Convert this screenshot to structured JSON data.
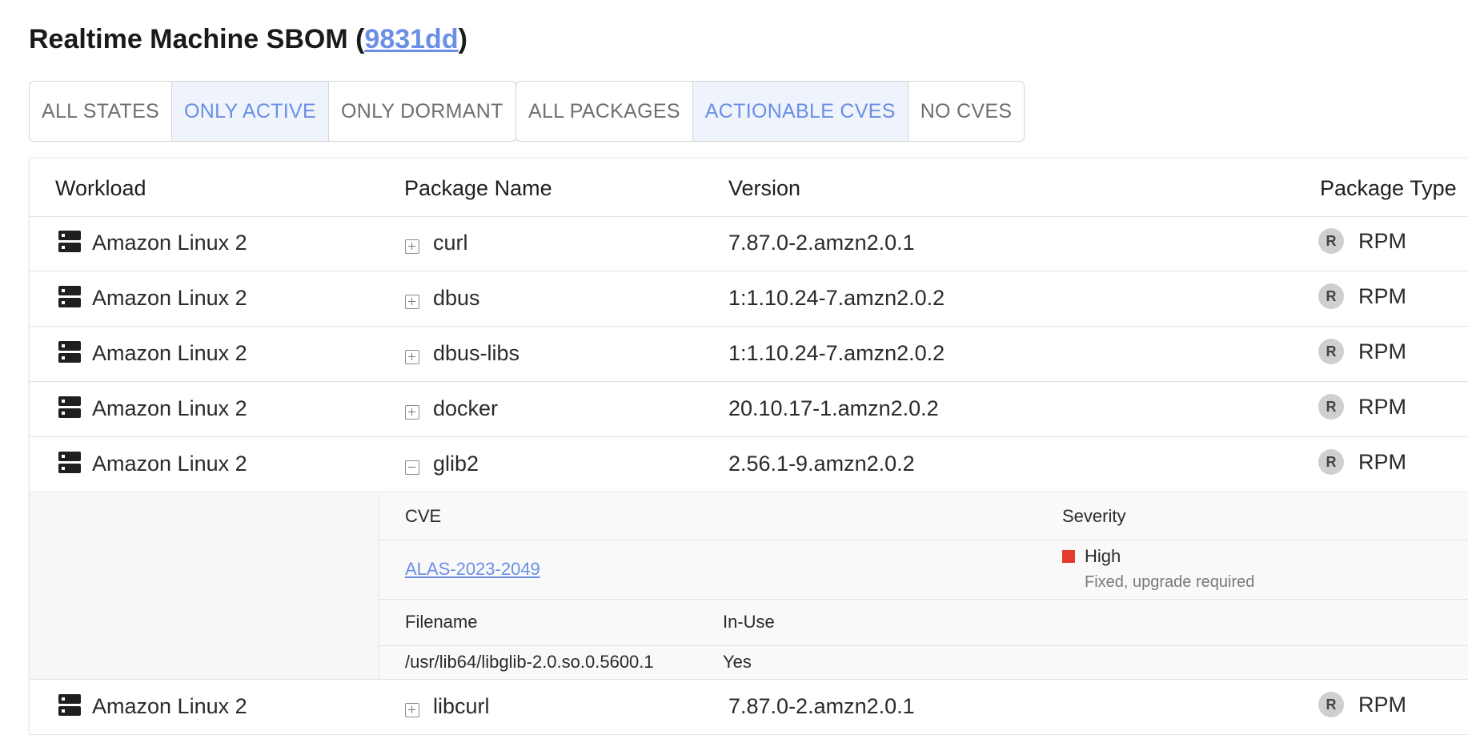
{
  "page": {
    "title_prefix": "Realtime Machine SBOM (",
    "title_hash": "9831dd",
    "title_suffix": ")"
  },
  "filters": {
    "states": [
      {
        "label": "ALL STATES",
        "active": false
      },
      {
        "label": "ONLY ACTIVE",
        "active": true
      },
      {
        "label": "ONLY DORMANT",
        "active": false
      }
    ],
    "packages": [
      {
        "label": "ALL PACKAGES",
        "active": false
      },
      {
        "label": "ACTIONABLE CVES",
        "active": true
      },
      {
        "label": "NO CVES",
        "active": false
      }
    ]
  },
  "table": {
    "headers": {
      "workload": "Workload",
      "package_name": "Package Name",
      "version": "Version",
      "package_type": "Package Type"
    },
    "rows": [
      {
        "workload": "Amazon Linux 2",
        "package": "curl",
        "version": "7.87.0-2.amzn2.0.1",
        "type_badge": "R",
        "type": "RPM",
        "expanded": false
      },
      {
        "workload": "Amazon Linux 2",
        "package": "dbus",
        "version": "1:1.10.24-7.amzn2.0.2",
        "type_badge": "R",
        "type": "RPM",
        "expanded": false
      },
      {
        "workload": "Amazon Linux 2",
        "package": "dbus-libs",
        "version": "1:1.10.24-7.amzn2.0.2",
        "type_badge": "R",
        "type": "RPM",
        "expanded": false
      },
      {
        "workload": "Amazon Linux 2",
        "package": "docker",
        "version": "20.10.17-1.amzn2.0.2",
        "type_badge": "R",
        "type": "RPM",
        "expanded": false
      },
      {
        "workload": "Amazon Linux 2",
        "package": "glib2",
        "version": "2.56.1-9.amzn2.0.2",
        "type_badge": "R",
        "type": "RPM",
        "expanded": true
      },
      {
        "workload": "Amazon Linux 2",
        "package": "libcurl",
        "version": "7.87.0-2.amzn2.0.1",
        "type_badge": "R",
        "type": "RPM",
        "expanded": false
      }
    ],
    "detail": {
      "cve_header": "CVE",
      "severity_header": "Severity",
      "cve_id": "ALAS-2023-2049",
      "severity": "High",
      "severity_color": "#e63a2e",
      "severity_note": "Fixed, upgrade required",
      "filename_header": "Filename",
      "inuse_header": "In-Use",
      "filename": "/usr/lib64/libglib-2.0.so.0.5600.1",
      "inuse": "Yes"
    }
  }
}
